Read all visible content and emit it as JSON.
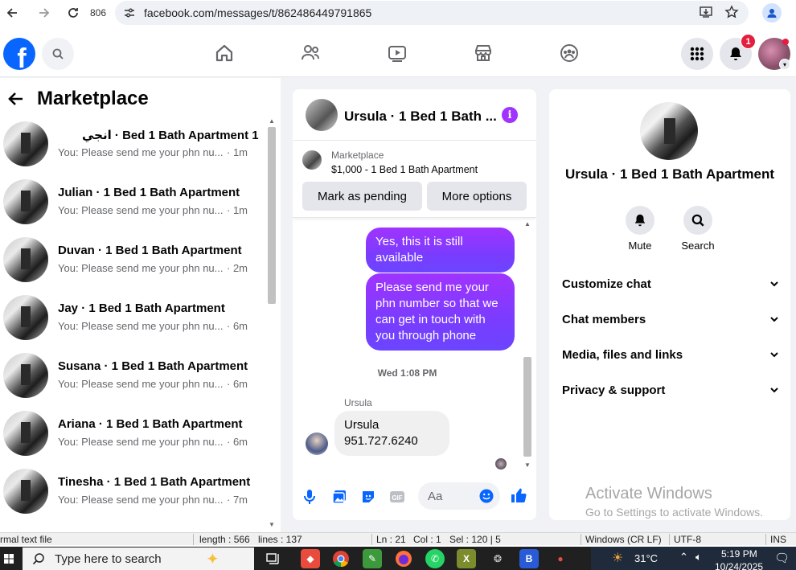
{
  "browser": {
    "tab_count": "806",
    "url": "facebook.com/messages/t/862486449791865"
  },
  "nav": {
    "notifications_count": "1"
  },
  "left_panel": {
    "title": "Marketplace",
    "conversations": [
      {
        "name": "انجي · Bed 1 Bath Apartment 1",
        "snippet": "You: Please send me your phn nu...",
        "time": "· 1m",
        "rtl": true
      },
      {
        "name": "Julian · 1 Bed 1 Bath Apartment",
        "snippet": "You: Please send me your phn nu...",
        "time": "· 1m"
      },
      {
        "name": "Duvan · 1 Bed 1 Bath Apartment",
        "snippet": "You: Please send me your phn nu...",
        "time": "· 2m"
      },
      {
        "name": "Jay · 1 Bed 1 Bath Apartment",
        "snippet": "You: Please send me your phn nu...",
        "time": "· 6m"
      },
      {
        "name": "Susana · 1 Bed 1 Bath Apartment",
        "snippet": "You: Please send me your phn nu...",
        "time": "· 6m"
      },
      {
        "name": "Ariana · 1 Bed 1 Bath Apartment",
        "snippet": "You: Please send me your phn nu...",
        "time": "· 6m"
      },
      {
        "name": "Tinesha · 1 Bed 1 Bath Apartment",
        "snippet": "You: Please send me your phn nu...",
        "time": "· 7m"
      }
    ]
  },
  "chat": {
    "header_name": "Ursula · 1 Bed 1 Bath ...",
    "marketplace_label": "Marketplace",
    "listing_title": "$1,000 - 1 Bed 1 Bath Apartment",
    "mark_pending_label": "Mark as pending",
    "more_options_label": "More options",
    "messages": {
      "out1": "Yes, this it is still available",
      "out2": "Please send me your phn number so that we can get in touch with you through phone",
      "timestamp": "Wed 1:08 PM",
      "sender": "Ursula",
      "in1_line1": "Ursula",
      "in1_line2": "951.727.6240"
    },
    "composer_placeholder": "Aa"
  },
  "info_panel": {
    "name": "Ursula · 1 Bed 1 Bath Apartment",
    "mute_label": "Mute",
    "search_label": "Search",
    "rows": [
      "Customize chat",
      "Chat members",
      "Media, files and links",
      "Privacy & support"
    ]
  },
  "watermark": {
    "line1": "Activate Windows",
    "line2": "Go to Settings to activate Windows."
  },
  "status_bar": {
    "type": "rmal text file",
    "length": "length : 566",
    "lines": "lines : 137",
    "ln": "Ln : 21",
    "col": "Col : 1",
    "sel": "Sel : 120 | 5",
    "eol": "Windows (CR LF)",
    "encoding": "UTF-8",
    "mode": "INS"
  },
  "taskbar": {
    "search_placeholder": "Type here to search",
    "temperature": "31°C",
    "time": "5:19 PM",
    "date": "10/24/2025"
  }
}
